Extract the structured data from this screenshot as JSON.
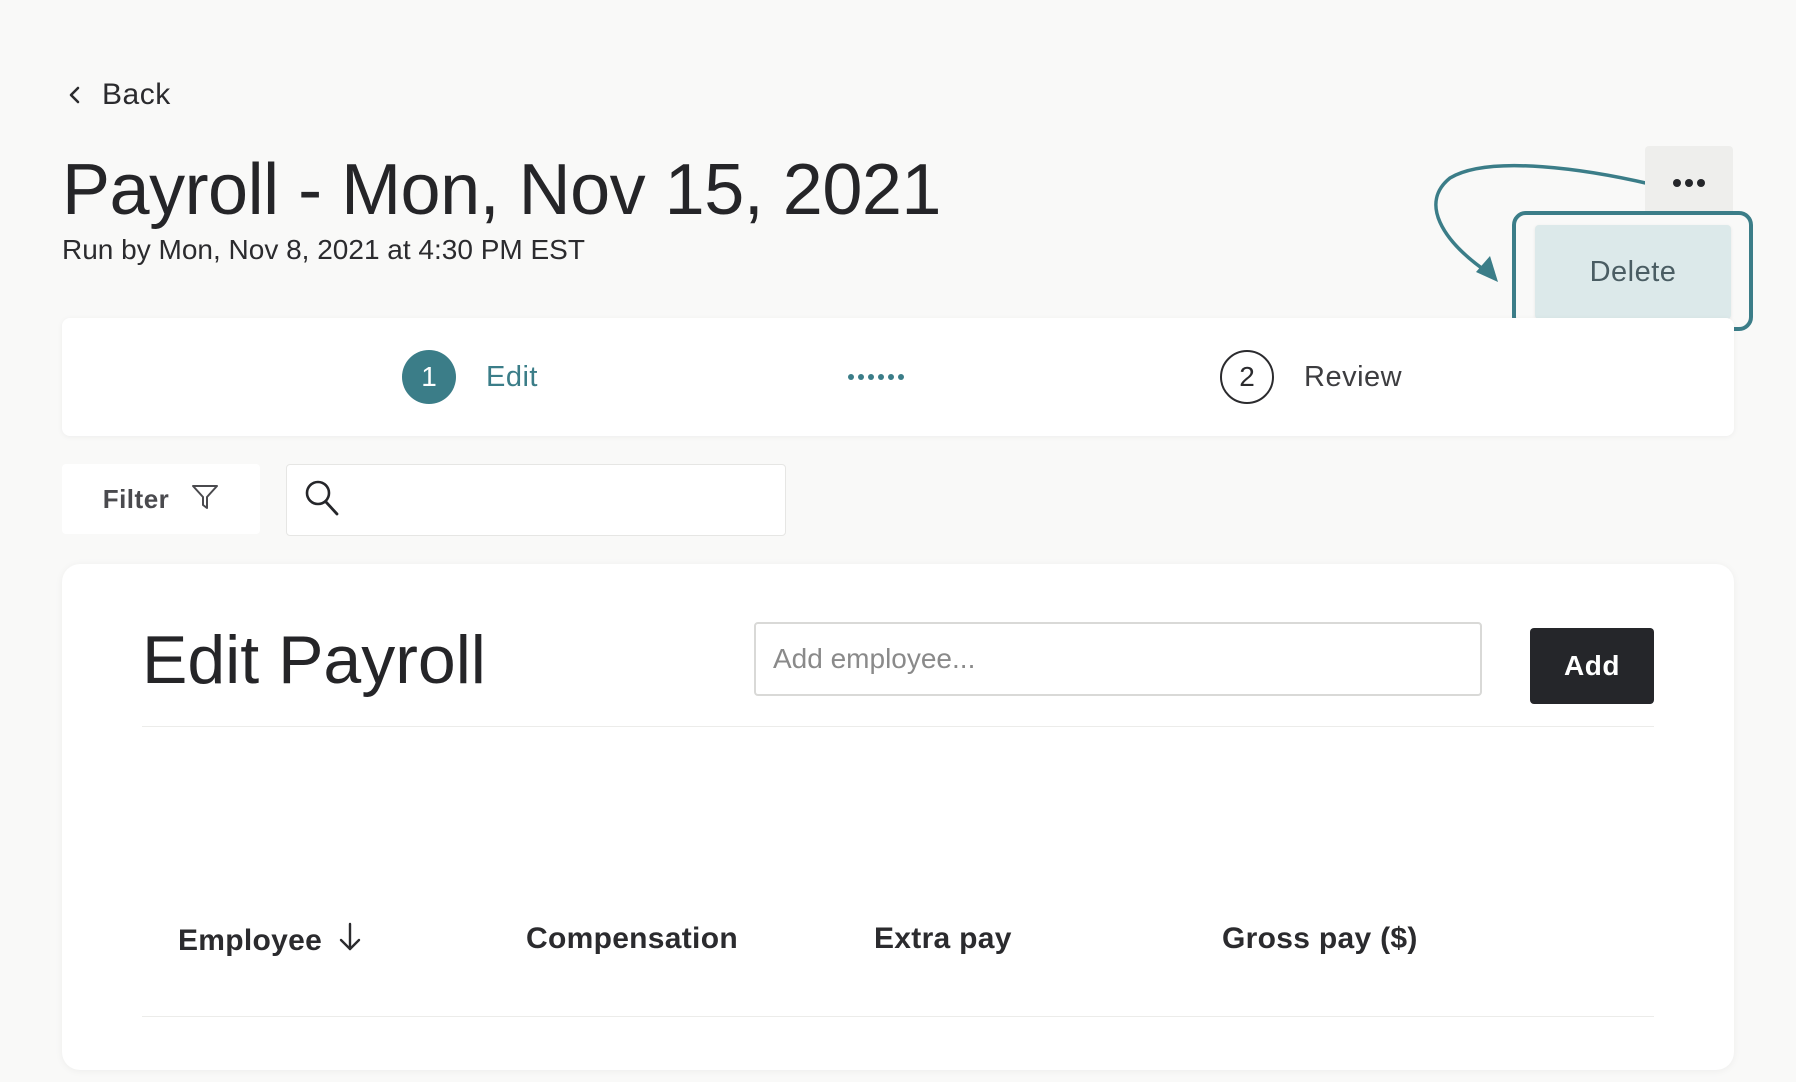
{
  "nav": {
    "back_label": "Back"
  },
  "header": {
    "title": "Payroll - Mon, Nov 15, 2021",
    "subtitle": "Run by Mon, Nov 8, 2021 at 4:30 PM EST"
  },
  "menu": {
    "items": [
      {
        "label": "Delete"
      }
    ]
  },
  "stepper": {
    "steps": [
      {
        "number": "1",
        "label": "Edit",
        "state": "active"
      },
      {
        "number": "2",
        "label": "Review",
        "state": "inactive"
      }
    ]
  },
  "toolbar": {
    "filter_label": "Filter",
    "search_value": ""
  },
  "edit_payroll": {
    "title": "Edit Payroll",
    "add_employee_placeholder": "Add employee...",
    "add_label": "Add",
    "columns": [
      "Employee",
      "Compensation",
      "Extra pay",
      "Gross pay ($)"
    ]
  },
  "colors": {
    "accent": "#3b7d88",
    "background": "#f9f9f8",
    "primary_button": "#25262a",
    "menu_highlight": "#dce9ea"
  }
}
